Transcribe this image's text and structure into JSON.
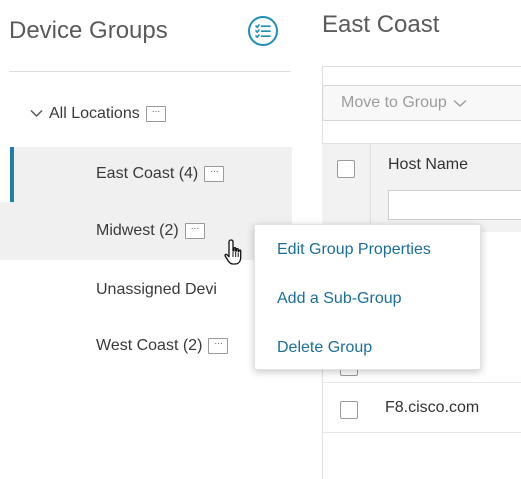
{
  "left_panel": {
    "title": "Device Groups",
    "tree": {
      "root_label": "All Locations",
      "items": [
        {
          "label": "East Coast (4)"
        },
        {
          "label": "Midwest (2)"
        },
        {
          "label": "Unassigned Devi"
        },
        {
          "label": "West Coast (2)"
        }
      ]
    },
    "more_glyph": "···"
  },
  "main": {
    "title": "East Coast",
    "move_button_label": "Move to Group",
    "table": {
      "host_header": "Host Name",
      "last_row_host": "F8.cisco.com"
    }
  },
  "context_menu": {
    "items": [
      {
        "label": "Edit Group Properties"
      },
      {
        "label": "Add a Sub-Group"
      },
      {
        "label": "Delete Group"
      }
    ]
  },
  "colors": {
    "accent": "#1f8fb5",
    "selected_bar": "#1f7fa8",
    "link": "#1a6f99"
  }
}
